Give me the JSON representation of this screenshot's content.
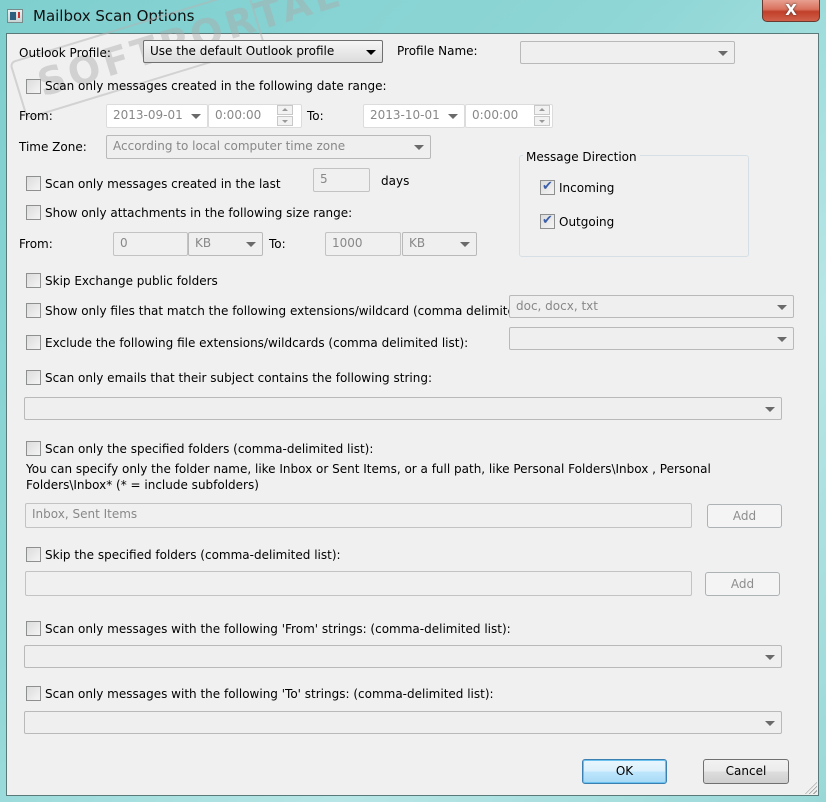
{
  "window": {
    "title": "Mailbox Scan Options",
    "close_label": "X"
  },
  "watermark": "SOFTPORTAL",
  "profile": {
    "outlook_profile_label": "Outlook Profile:",
    "outlook_profile_value": "Use the default Outlook profile",
    "profile_name_label": "Profile Name:",
    "profile_name_value": ""
  },
  "date_range": {
    "checkbox_label": "Scan only messages created in the following date range:",
    "checked": false,
    "from_label": "From:",
    "from_date": "2013-09-01",
    "from_time": "0:00:00",
    "to_label": "To:",
    "to_date": "2013-10-01",
    "to_time": "0:00:00",
    "time_zone_label": "Time Zone:",
    "time_zone_value": "According to local computer time zone"
  },
  "last_days": {
    "checkbox_label": "Scan only messages created in the last",
    "checked": false,
    "value": "5",
    "unit": "days"
  },
  "message_direction": {
    "title": "Message Direction",
    "incoming_label": "Incoming",
    "incoming_checked": true,
    "outgoing_label": "Outgoing",
    "outgoing_checked": true
  },
  "attachment_size": {
    "checkbox_label": "Show only attachments in the following size range:",
    "checked": false,
    "from_label": "From:",
    "from_value": "0",
    "from_unit": "KB",
    "to_label": "To:",
    "to_value": "1000",
    "to_unit": "KB"
  },
  "skip_public": {
    "checkbox_label": "Skip Exchange public folders",
    "checked": false
  },
  "include_ext": {
    "checkbox_label": "Show only files that match the following extensions/wildcard (comma delimited)",
    "checked": false,
    "value": "doc, docx, txt"
  },
  "exclude_ext": {
    "checkbox_label": "Exclude the following file extensions/wildcards (comma delimited list):",
    "checked": false,
    "value": ""
  },
  "subject": {
    "checkbox_label": "Scan only emails that their subject contains the following string:",
    "checked": false,
    "value": ""
  },
  "scan_folders": {
    "checkbox_label": "Scan only the specified folders (comma-delimited list):",
    "checked": false,
    "help_line1": "You can specify only the folder name, like Inbox or Sent Items, or a full path, like Personal Folders\\Inbox , Personal",
    "help_line2": "Folders\\Inbox*  (* = include subfolders)",
    "value": "Inbox, Sent Items",
    "add_label": "Add"
  },
  "skip_folders": {
    "checkbox_label": "Skip the specified folders (comma-delimited list):",
    "checked": false,
    "value": "",
    "add_label": "Add"
  },
  "from_strings": {
    "checkbox_label": "Scan only messages with the following 'From' strings: (comma-delimited list):",
    "checked": false,
    "value": ""
  },
  "to_strings": {
    "checkbox_label": "Scan only messages with the following 'To' strings: (comma-delimited list):",
    "checked": false,
    "value": ""
  },
  "buttons": {
    "ok": "OK",
    "cancel": "Cancel"
  }
}
